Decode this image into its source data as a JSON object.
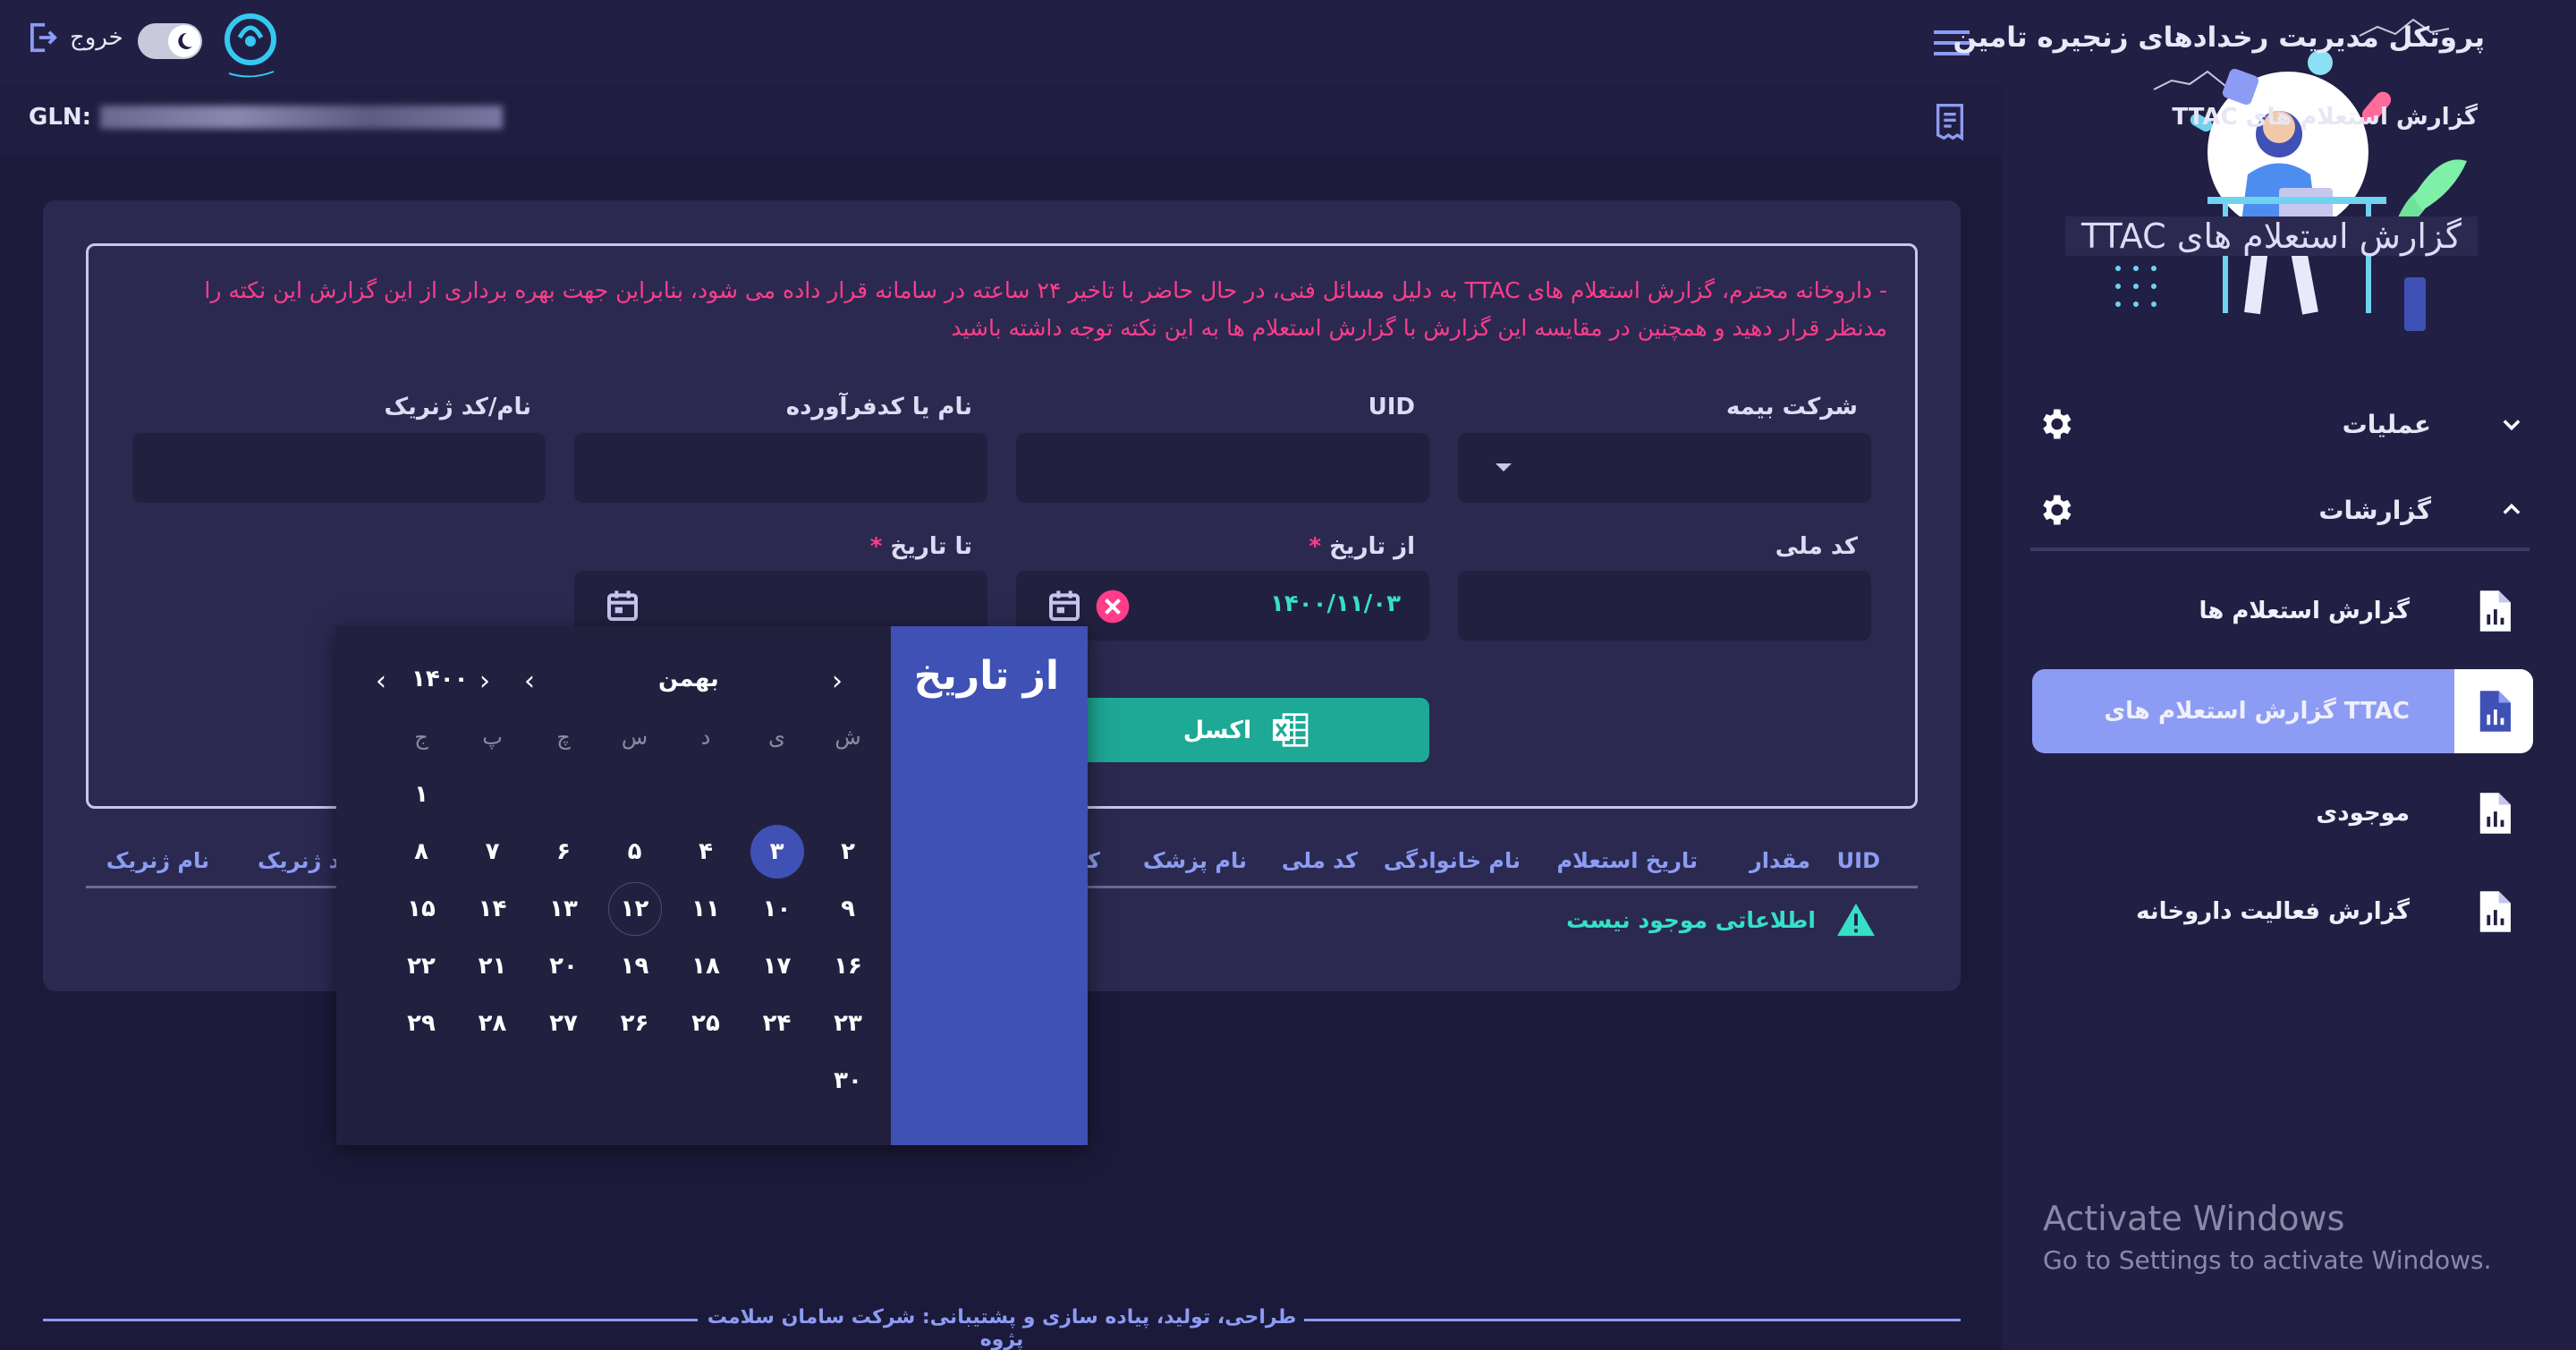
{
  "header": {
    "title": "پروتکل مدیریت رخدادهای زنجیره تامین",
    "logout_label": "خروج",
    "gln_label": "GLN:",
    "page_title": "گزارش استعلام های TTAC"
  },
  "sidebar": {
    "sections": [
      {
        "label": "عملیات",
        "expanded": false
      },
      {
        "label": "گزارشات",
        "expanded": true
      }
    ],
    "items": [
      {
        "label": "گزارش استعلام ها"
      },
      {
        "label": "گزارش استعلام های TTAC",
        "active": true
      },
      {
        "label": "موجودی"
      },
      {
        "label": "گزارش فعالیت داروخانه"
      }
    ],
    "watermark_title": "Activate Windows",
    "watermark_sub": "Go to Settings to activate Windows."
  },
  "form": {
    "legend": "گزارش استعلام های TTAC",
    "notice": "- داروخانه محترم، گزارش استعلام های TTAC به دلیل مسائل فنی، در حال حاضر با تاخیر ۲۴ ساعته در سامانه قرار داده می شود، بنابراین جهت بهره برداری از این گزارش این نکته را مدنظر قرار دهید و همچنین در مقایسه این گزارش با گزارش استعلام ها به این نکته توجه داشته باشید",
    "insurance_label": "شرکت بیمه",
    "uid_label": "UID",
    "supplier_label": "نام یا کدفرآورده",
    "generic_label": "نام/کد ژنریک",
    "national_code_label": "کد ملی",
    "from_date_label": "از تاریخ",
    "to_date_label": "تا تاریخ",
    "required_mark": "*",
    "from_date_value": "۱۴۰۰/۱۱/۰۳",
    "excel_label": "اکسل"
  },
  "table": {
    "headers": [
      "UID",
      "مقدار",
      "تاریخ استعلام",
      "نام خانوادگی",
      "کد ملی",
      "نام پزشک",
      "کد",
      "د ژنریک",
      "نام ژنریک"
    ],
    "empty_message": "اطلاعاتی موجود نیست"
  },
  "datepicker": {
    "title": "از تاریخ",
    "month": "بهمن",
    "year": "۱۴۰۰",
    "weekdays": [
      "ش",
      "ی",
      "د",
      "س",
      "چ",
      "پ",
      "ج"
    ],
    "weeks": [
      [
        "",
        "",
        "",
        "",
        "",
        "",
        "۱"
      ],
      [
        "۲",
        "۳",
        "۴",
        "۵",
        "۶",
        "۷",
        "۸"
      ],
      [
        "۹",
        "۱۰",
        "۱۱",
        "۱۲",
        "۱۳",
        "۱۴",
        "۱۵"
      ],
      [
        "۱۶",
        "۱۷",
        "۱۸",
        "۱۹",
        "۲۰",
        "۲۱",
        "۲۲"
      ],
      [
        "۲۳",
        "۲۴",
        "۲۵",
        "۲۶",
        "۲۷",
        "۲۸",
        "۲۹"
      ],
      [
        "۳۰",
        "",
        "",
        "",
        "",
        "",
        ""
      ]
    ],
    "selected": "۳",
    "today": "۱۲"
  },
  "footer": {
    "text": "طراحی، تولید، پیاده سازی و پشتیبانی: شرکت سامان سلامت پژوه"
  },
  "colors": {
    "bg": "#1c1a3a",
    "panel": "#2b2950",
    "accent": "#8c9cf4",
    "primary": "#3f51b5",
    "success": "#1ea896",
    "warning": "#ff3d8b",
    "teal": "#35e0c6"
  }
}
